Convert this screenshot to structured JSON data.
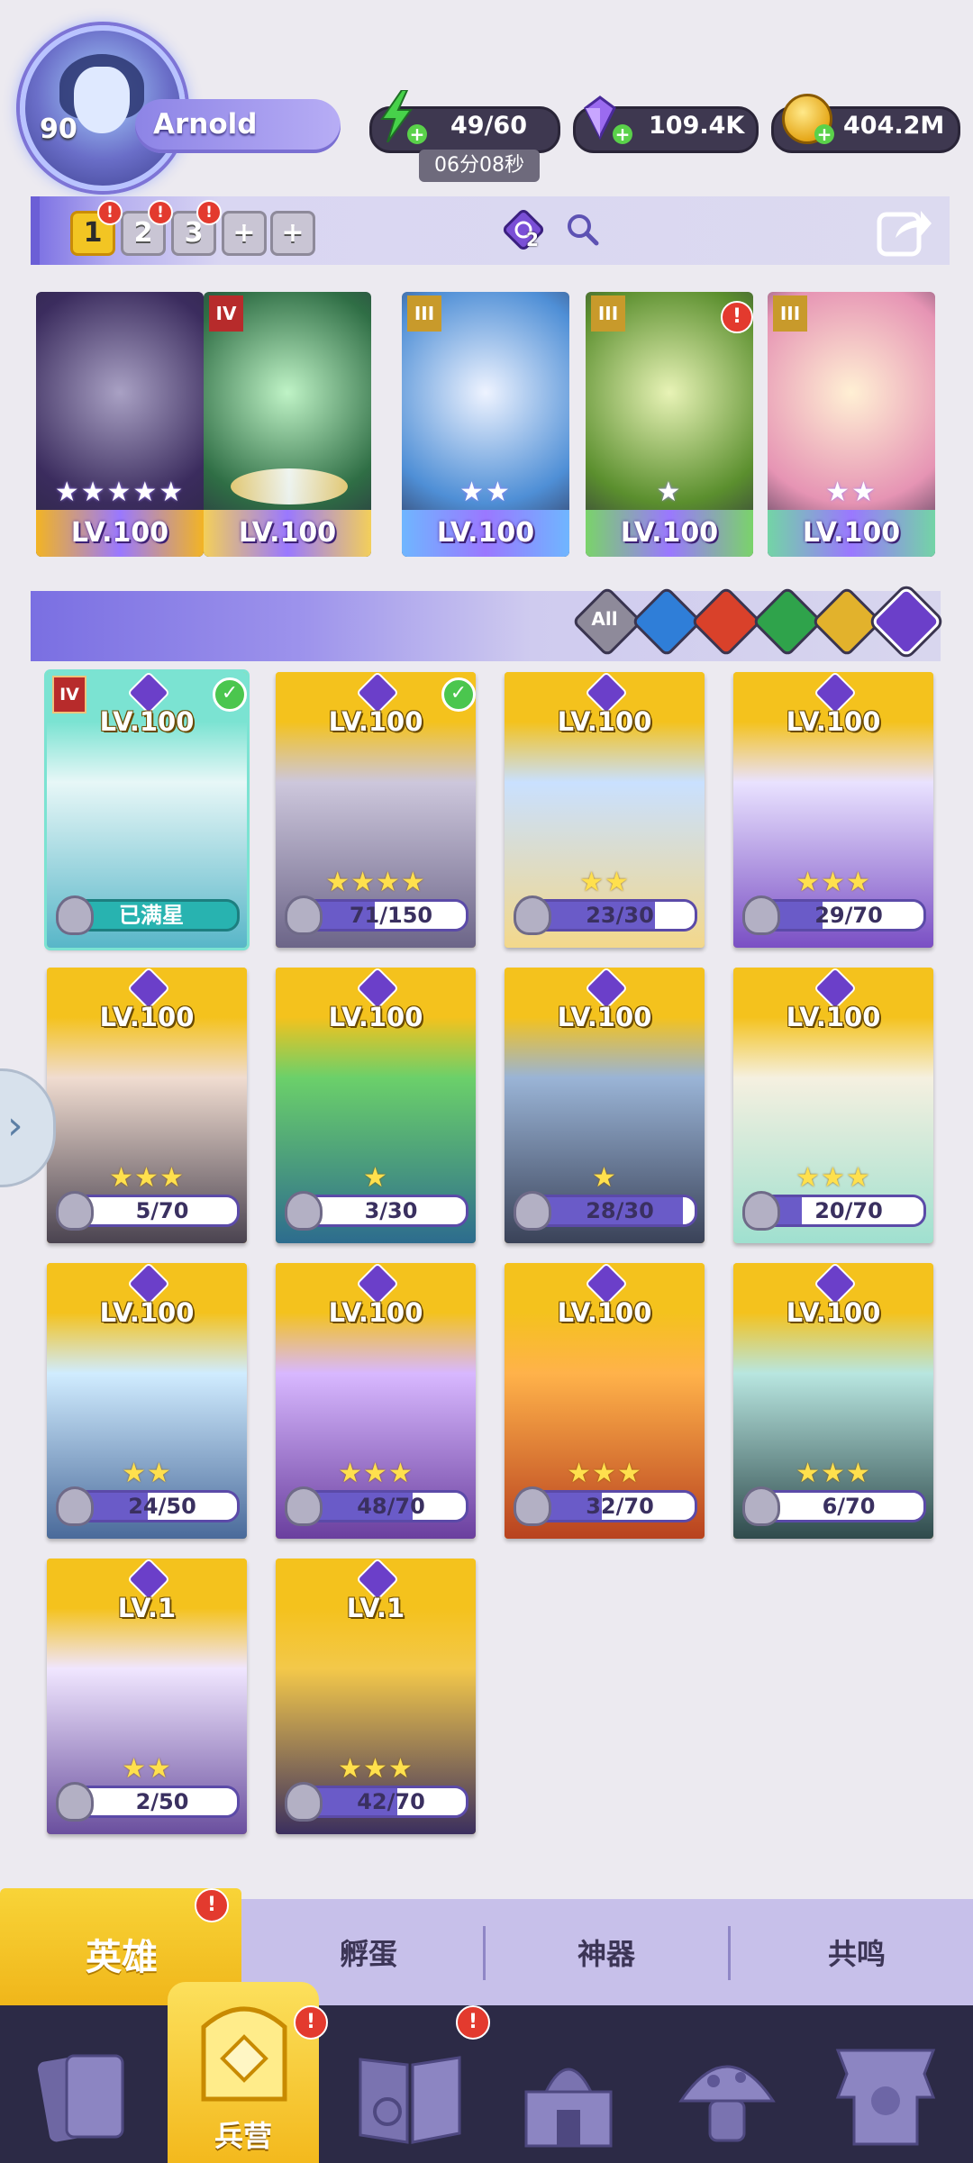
{
  "player": {
    "level": "90",
    "name": "Arnold"
  },
  "resources": {
    "energy": "49/60",
    "energy_timer": "06分08秒",
    "gems": "109.4K",
    "coins": "404.2M"
  },
  "team": {
    "slots": [
      "1",
      "2",
      "3",
      "+",
      "+"
    ],
    "element_count": "2"
  },
  "deployed": [
    {
      "level": "LV.100",
      "stars": "★★★★★",
      "rank": "",
      "art": "#3b2c5e",
      "art2": "#a9a1c4",
      "band": "#f2b424"
    },
    {
      "level": "LV.100",
      "stars": "",
      "rank": "IV",
      "art": "#2f6e45",
      "art2": "#bff3c6",
      "band": "#f3cf5a"
    },
    {
      "level": "LV.100",
      "stars": "★★",
      "rank": "III",
      "art": "#4f8fd6",
      "art2": "#eef3ff",
      "band": "#6fb6ff"
    },
    {
      "level": "LV.100",
      "stars": "★",
      "rank": "III",
      "art": "#5b8f2e",
      "art2": "#e8f3b6",
      "band": "#7ad36a"
    },
    {
      "level": "LV.100",
      "stars": "★★",
      "rank": "III",
      "art": "#e694b4",
      "art2": "#fff0d4",
      "band": "#73d4a6"
    }
  ],
  "filters": {
    "all_label": "All",
    "items": [
      {
        "name": "all",
        "color": "#8e8a9a"
      },
      {
        "name": "water",
        "color": "#2f7ed8"
      },
      {
        "name": "fire",
        "color": "#d9412a"
      },
      {
        "name": "nature",
        "color": "#2fa34b"
      },
      {
        "name": "light",
        "color": "#e2b22c"
      },
      {
        "name": "dark",
        "color": "#6b3fc9"
      }
    ]
  },
  "heroes": [
    {
      "level": "LV.100",
      "stars": "",
      "progress": "已满星",
      "fill": 1.0,
      "full": true,
      "rank": "IV",
      "check": true,
      "art": "#58b6c8",
      "art2": "#e7f7f7",
      "frame": "#7be3d2"
    },
    {
      "level": "LV.100",
      "stars": "★★★★",
      "progress": "71/150",
      "fill": 0.47,
      "full": false,
      "rank": "",
      "check": true,
      "art": "#6c6588",
      "art2": "#cdc7dc",
      "frame": "#f4c21d"
    },
    {
      "level": "LV.100",
      "stars": "★★",
      "progress": "23/30",
      "fill": 0.77,
      "full": false,
      "rank": "",
      "check": false,
      "art": "#f3d88b",
      "art2": "#c9e0ff",
      "frame": "#f4c21d"
    },
    {
      "level": "LV.100",
      "stars": "★★★",
      "progress": "29/70",
      "fill": 0.41,
      "full": false,
      "rank": "",
      "check": false,
      "art": "#7a4fc4",
      "art2": "#e9e2ff",
      "frame": "#f4c21d"
    },
    {
      "level": "LV.100",
      "stars": "★★★",
      "progress": "5/70",
      "fill": 0.07,
      "full": false,
      "rank": "",
      "check": false,
      "art": "#4a4350",
      "art2": "#f0dcd0",
      "frame": "#f4c21d"
    },
    {
      "level": "LV.100",
      "stars": "★",
      "progress": "3/30",
      "fill": 0.1,
      "full": false,
      "rank": "",
      "check": false,
      "art": "#2d6c8e",
      "art2": "#6bd06a",
      "frame": "#f4c21d"
    },
    {
      "level": "LV.100",
      "stars": "★",
      "progress": "28/30",
      "fill": 0.93,
      "full": false,
      "rank": "",
      "check": false,
      "art": "#3a4258",
      "art2": "#9ab4d6",
      "frame": "#f4c21d"
    },
    {
      "level": "LV.100",
      "stars": "★★★",
      "progress": "20/70",
      "fill": 0.29,
      "full": false,
      "rank": "",
      "check": false,
      "art": "#9fe0cf",
      "art2": "#f5f0e0",
      "frame": "#f4c21d"
    },
    {
      "level": "LV.100",
      "stars": "★★",
      "progress": "24/50",
      "fill": 0.48,
      "full": false,
      "rank": "",
      "check": false,
      "art": "#4a6a9a",
      "art2": "#d0ecff",
      "frame": "#f4c21d"
    },
    {
      "level": "LV.100",
      "stars": "★★★",
      "progress": "48/70",
      "fill": 0.69,
      "full": false,
      "rank": "",
      "check": false,
      "art": "#6a3f9e",
      "art2": "#d8b8ff",
      "frame": "#f4c21d"
    },
    {
      "level": "LV.100",
      "stars": "★★★",
      "progress": "32/70",
      "fill": 0.46,
      "full": false,
      "rank": "",
      "check": false,
      "art": "#b8421f",
      "art2": "#ffb24a",
      "frame": "#f4c21d"
    },
    {
      "level": "LV.100",
      "stars": "★★★",
      "progress": "6/70",
      "fill": 0.09,
      "full": false,
      "rank": "",
      "check": false,
      "art": "#2f4a4c",
      "art2": "#b8e6e0",
      "frame": "#f4c21d"
    },
    {
      "level": "LV.1",
      "stars": "★★",
      "progress": "2/50",
      "fill": 0.04,
      "full": false,
      "rank": "",
      "check": false,
      "art": "#6a4f9e",
      "art2": "#f0e6ff",
      "frame": "#f4c21d"
    },
    {
      "level": "LV.1",
      "stars": "★★★",
      "progress": "42/70",
      "fill": 0.6,
      "full": false,
      "rank": "",
      "check": false,
      "art": "#3b2f5e",
      "art2": "#f3c84a",
      "frame": "#f4c21d"
    }
  ],
  "subtabs": {
    "heroes": "英雄",
    "hatch": "孵蛋",
    "artifact": "神器",
    "resonance": "共鸣"
  },
  "nav": {
    "barracks": "兵营"
  },
  "alerts": {
    "mark": "!"
  }
}
